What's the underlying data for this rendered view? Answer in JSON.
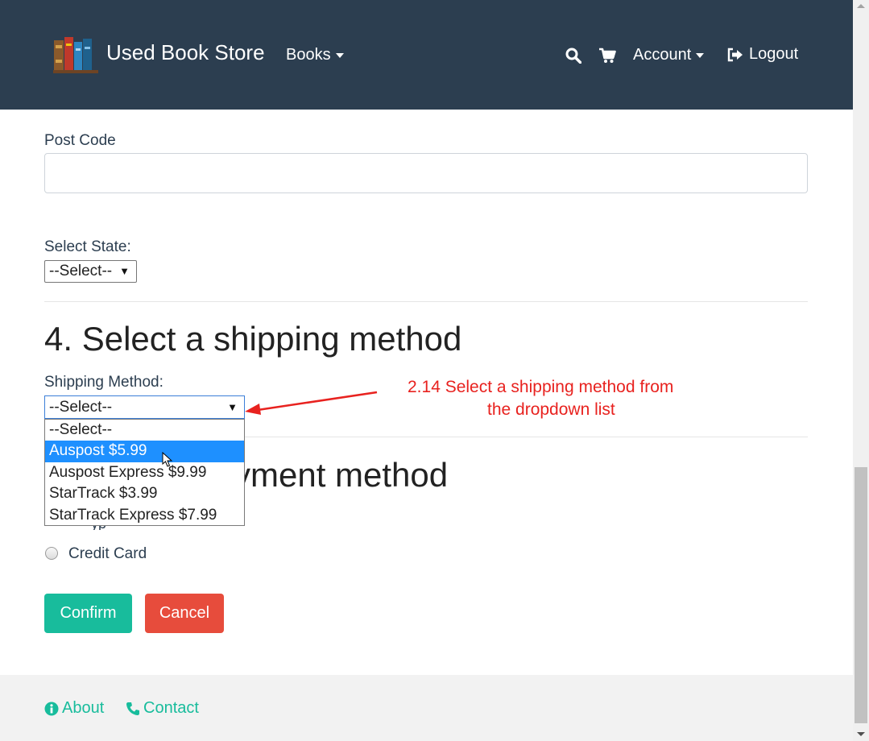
{
  "header": {
    "brand_name": "Used Book Store",
    "books_label": "Books",
    "account_label": "Account",
    "logout_label": "Logout",
    "icons": [
      "books-logo-icon",
      "search-icon",
      "cart-icon",
      "logout-icon"
    ]
  },
  "form": {
    "post_code_label": "Post Code",
    "post_code_value": "",
    "state_label": "Select State:",
    "state_selected": "--Select--",
    "shipping_heading": "4. Select a shipping method",
    "shipping_label": "Shipping Method:",
    "shipping_selected": "--Select--",
    "shipping_options": [
      "--Select--",
      "Auspost $5.99",
      "Auspost Express $9.99",
      "StarTrack $3.99",
      "StarTrack Express $7.99"
    ],
    "highlighted_option": "Auspost $5.99",
    "payment_heading_visible": "yment method",
    "payment_type_partial": "yp",
    "payment_option": "Credit Card"
  },
  "annotation": {
    "line1": "2.14  Select a shipping method from",
    "line2": "the dropdown list",
    "color": "#e8221f"
  },
  "buttons": {
    "confirm_label": "Confirm",
    "cancel_label": "Cancel"
  },
  "footer": {
    "about_label": "About",
    "contact_label": "Contact"
  },
  "colors": {
    "navbar": "#2c3e50",
    "accent": "#18bc9c",
    "danger": "#e74c3c",
    "highlight": "#1e90ff"
  }
}
